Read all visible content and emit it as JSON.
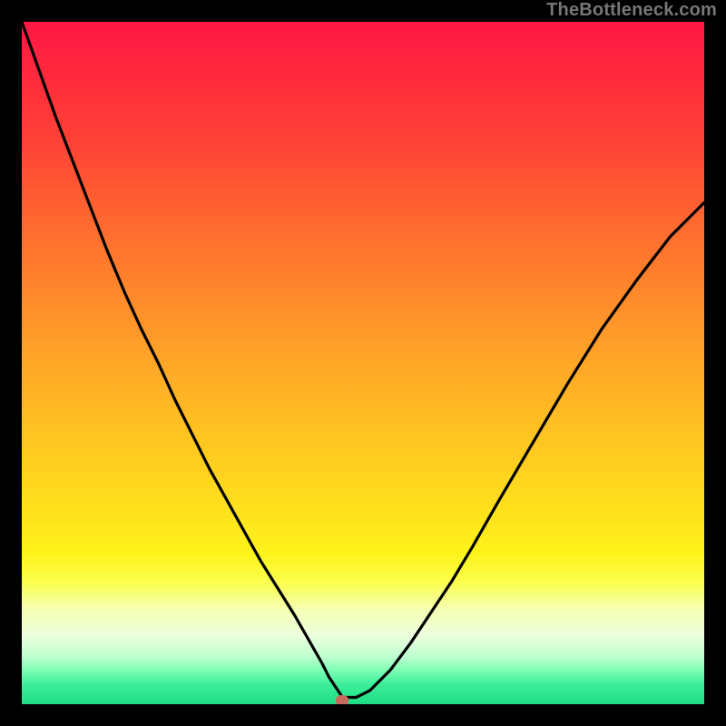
{
  "watermark": "TheBottleneck.com",
  "marker": {
    "x_pct": 47.0,
    "y_pct": 99.5
  },
  "chart_data": {
    "type": "line",
    "title": "",
    "xlabel": "",
    "ylabel": "",
    "xlim": [
      0,
      100
    ],
    "ylim": [
      0,
      100
    ],
    "grid": false,
    "series": [
      {
        "name": "bottleneck-curve",
        "x": [
          0,
          2.5,
          5,
          7.5,
          10,
          12.5,
          15,
          17.5,
          20,
          22.5,
          25,
          27.5,
          30,
          32.5,
          35,
          37.5,
          40,
          42,
          44,
          45,
          46,
          47,
          49,
          51,
          54,
          57,
          60,
          63,
          66,
          70,
          75,
          80,
          85,
          90,
          95,
          100
        ],
        "y": [
          100,
          93,
          86,
          79.5,
          73,
          66.5,
          60.5,
          55,
          50,
          44.5,
          39.5,
          34.5,
          30,
          25.5,
          21,
          17,
          13,
          9.5,
          6,
          4,
          2.5,
          1,
          1,
          2,
          5,
          9,
          13.5,
          18,
          23,
          30,
          38.5,
          47,
          55,
          62,
          68.5,
          73.5
        ]
      }
    ],
    "marker_point": {
      "x": 47,
      "y": 0.5
    },
    "background_gradient": {
      "top": "#ff1744",
      "mid_upper": "#ff8f2a",
      "mid": "#fff31a",
      "mid_lower": "#f6ffb0",
      "bottom": "#1ddc85"
    },
    "annotations": [
      {
        "text": "TheBottleneck.com",
        "position": "top-right"
      }
    ]
  }
}
